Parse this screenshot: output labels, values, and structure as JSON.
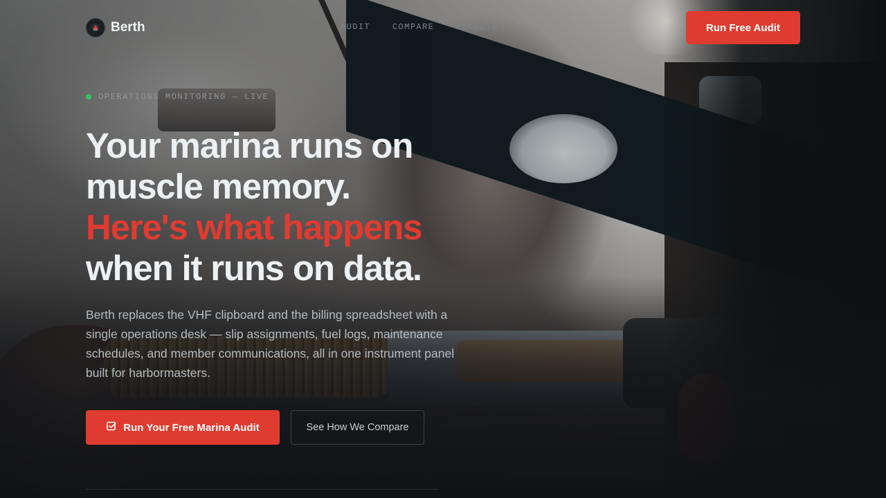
{
  "brand": {
    "name": "Berth",
    "accent_color": "#e03b30",
    "live_color": "#2fc46a"
  },
  "nav": {
    "links": [
      "AUDIT",
      "COMPARE",
      "RESULTS"
    ],
    "cta_label": "Run Free Audit"
  },
  "hero": {
    "status_text": "OPERATIONS MONITORING — LIVE",
    "headline_line1": "Your marina runs on",
    "headline_line2": "muscle memory.",
    "headline_accent": "Here's what happens",
    "headline_line4": "when it runs on data.",
    "subtext": "Berth replaces the VHF clipboard and the billing spreadsheet with a single operations desk — slip assignments, fuel logs, maintenance schedules, and member communications, all in one instrument panel built for harbormasters.",
    "primary_cta_label": "Run Your Free Marina Audit",
    "primary_cta_icon": "checkbox-icon",
    "secondary_cta_label": "See How We Compare"
  }
}
